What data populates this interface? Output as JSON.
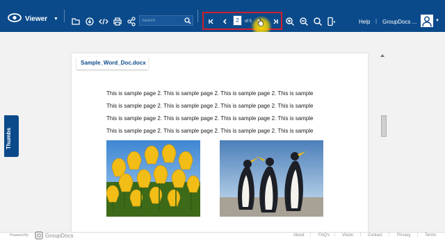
{
  "app": {
    "name": "Viewer"
  },
  "toolbar": {
    "search_placeholder": "Search",
    "icons": [
      "folder-icon",
      "download-icon",
      "code-icon",
      "print-icon",
      "share-icon",
      "search-icon"
    ],
    "zoom_icons": [
      "zoom-in-icon",
      "zoom-out-icon",
      "zoom-icon",
      "mobile-view-icon"
    ]
  },
  "pager": {
    "current_page": "2",
    "total_label": "of 5"
  },
  "header_right": {
    "help": "Help",
    "divider": "|",
    "user": "GroupDocs ..."
  },
  "sidebar": {
    "thumbs_label": "Thumbs"
  },
  "document": {
    "tab_title": "Sample_Word_Doc.docx",
    "lines": [
      "This is sample page 2. This is sample page 2. This is sample page 2. This is sample",
      "This is sample page 2. This is sample page 2. This is sample page 2. This is sample",
      "This is sample page 2. This is sample page 2. This is sample page 2. This is sample",
      "This is sample page 2. This is sample page 2. This is sample page 2. This is sample"
    ],
    "images": [
      "tulips-image",
      "penguins-image"
    ]
  },
  "footer": {
    "powered_by": "Powered By",
    "brand": "GroupDocs",
    "links": [
      "About",
      "FAQ's",
      "Vision",
      "Contact",
      "Privacy",
      "Terms"
    ]
  },
  "colors": {
    "header": "#0b4a8a",
    "highlight": "#d31f2c",
    "link": "#8a8a8a"
  }
}
